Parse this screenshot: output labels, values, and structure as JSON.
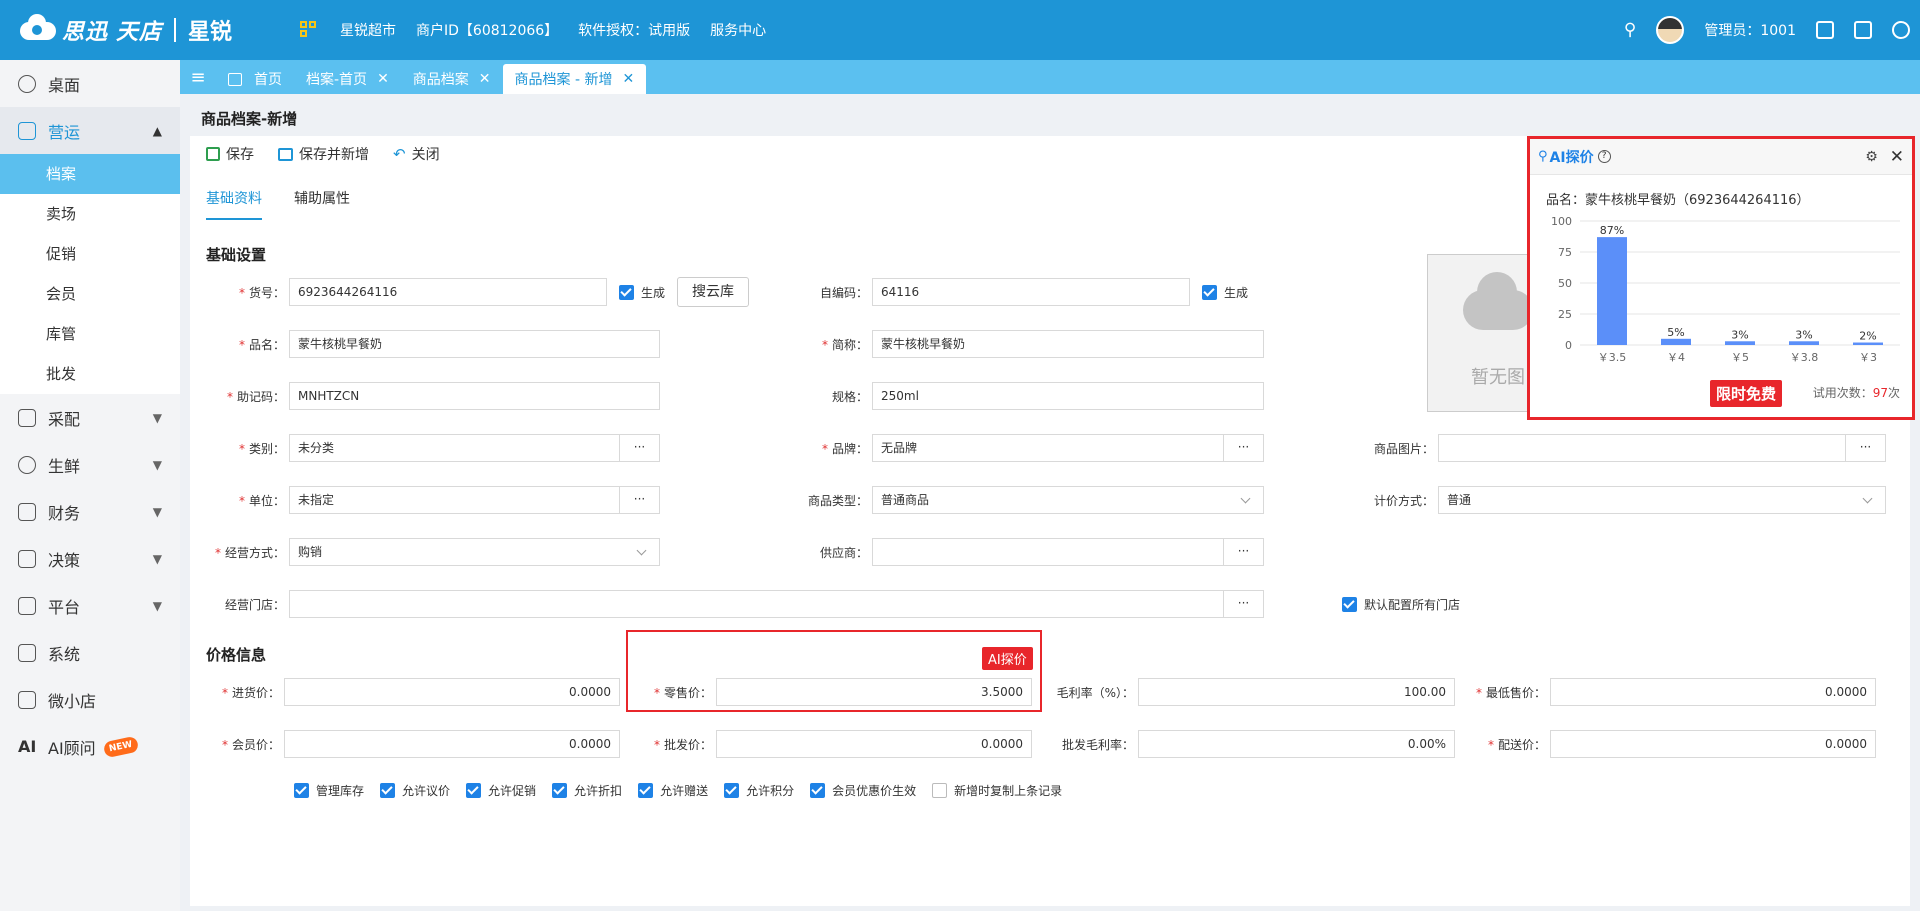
{
  "brand": {
    "logo": "思迅",
    "logo2": "天店",
    "product": "星锐"
  },
  "topnav": {
    "store": "星锐超市",
    "merchant": "商户ID【60812066】",
    "license": "软件授权：试用版",
    "service": "服务中心"
  },
  "user": {
    "label": "管理员：1001"
  },
  "sidebar": {
    "desk": "桌面",
    "ops": "营运",
    "ops_sub": [
      "档案",
      "卖场",
      "促销",
      "会员",
      "库管",
      "批发"
    ],
    "purchase": "采配",
    "fresh": "生鲜",
    "finance": "财务",
    "decision": "决策",
    "platform": "平台",
    "system": "系统",
    "mini": "微小店",
    "ai": "AI顾问",
    "new_badge": "NEW"
  },
  "tabs": [
    "首页",
    "档案-首页",
    "商品档案",
    "商品档案 - 新增"
  ],
  "page": {
    "title": "商品档案-新增"
  },
  "toolbar": {
    "save": "保存",
    "save_new": "保存并新增",
    "close": "关闭"
  },
  "subtabs": [
    "基础资料",
    "辅助属性"
  ],
  "basic": {
    "title": "基础设置",
    "code_label": "货号：",
    "code": "6923644264116",
    "gen": "生成",
    "cloud_btn": "搜云库",
    "self_label": "自编码：",
    "self_code": "64116",
    "gen2": "生成",
    "name_label": "品名：",
    "name": "蒙牛核桃早餐奶",
    "short_label": "简称：",
    "short": "蒙牛核桃早餐奶",
    "mnemonic_label": "助记码：",
    "mnemonic": "MNHTZCN",
    "spec_label": "规格：",
    "spec": "250ml",
    "category_label": "类别：",
    "category": "未分类",
    "brand_label": "品牌：",
    "brand": "无品牌",
    "image_label": "商品图片：",
    "image": "",
    "unit_label": "单位：",
    "unit": "未指定",
    "type_label": "商品类型：",
    "type": "普通商品",
    "pricing_label": "计价方式：",
    "pricing": "普通",
    "mode_label": "经营方式：",
    "mode": "购销",
    "supplier_label": "供应商：",
    "supplier": "",
    "stores_label": "经营门店：",
    "stores": "",
    "default_stores": "默认配置所有门店",
    "no_image": "暂无图"
  },
  "price": {
    "title": "价格信息",
    "purchase_label": "进货价：",
    "purchase": "0.0000",
    "retail_label": "零售价：",
    "retail": "3.5000",
    "margin_label": "毛利率（%）：",
    "margin": "100.00",
    "min_label": "最低售价：",
    "min": "0.0000",
    "member_label": "会员价：",
    "member": "0.0000",
    "wholesale_label": "批发价：",
    "wholesale": "0.0000",
    "wmargin_label": "批发毛利率：",
    "wmargin": "0.00%",
    "dist_label": "配送价：",
    "dist": "0.0000",
    "ai_tag": "AI探价"
  },
  "checks": [
    {
      "label": "管理库存",
      "checked": true
    },
    {
      "label": "允许议价",
      "checked": true
    },
    {
      "label": "允许促销",
      "checked": true
    },
    {
      "label": "允许折扣",
      "checked": true
    },
    {
      "label": "允许赠送",
      "checked": true
    },
    {
      "label": "允许积分",
      "checked": true
    },
    {
      "label": "会员优惠价生效",
      "checked": true
    },
    {
      "label": "新增时复制上条记录",
      "checked": false
    }
  ],
  "popup": {
    "title": "AI探价",
    "product": "品名：蒙牛核桃早餐奶（6923644264116）",
    "free": "限时免费",
    "trial_label": "试用次数：",
    "trial_count": "97",
    "trial_unit": "次"
  },
  "chart_data": {
    "type": "bar",
    "categories": [
      "￥3.5",
      "￥4",
      "￥5",
      "￥3.8",
      "￥3"
    ],
    "values": [
      87,
      5,
      3,
      3,
      2
    ],
    "labels": [
      "87%",
      "5%",
      "3%",
      "3%",
      "2%"
    ],
    "yticks": [
      "100",
      "75",
      "50",
      "25",
      "0"
    ],
    "ylim": [
      0,
      100
    ],
    "grid": true,
    "color": "#5b8ff9"
  }
}
